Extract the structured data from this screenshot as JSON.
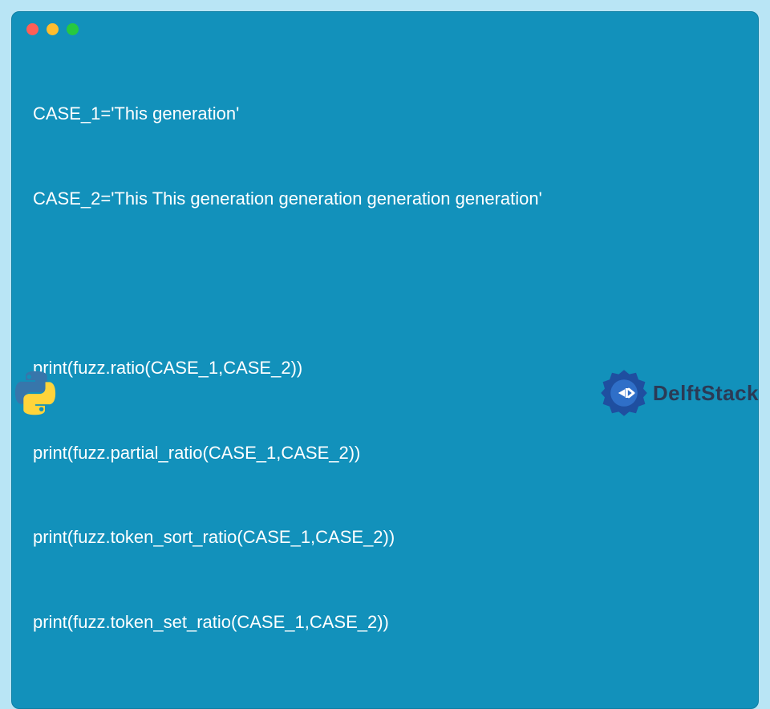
{
  "code": {
    "lines": [
      "CASE_1='This generation'",
      "CASE_2='This This generation generation generation generation'",
      "",
      "print(fuzz.ratio(CASE_1,CASE_2))",
      "print(fuzz.partial_ratio(CASE_1,CASE_2))",
      "print(fuzz.token_sort_ratio(CASE_1,CASE_2))",
      "print(fuzz.token_set_ratio(CASE_1,CASE_2))"
    ]
  },
  "window": {
    "traffic_colors": {
      "close": "#ff5f56",
      "min": "#ffbd2e",
      "max": "#27c93f"
    }
  },
  "brand": {
    "name": "DelftStack"
  },
  "icons": {
    "language": "python"
  }
}
